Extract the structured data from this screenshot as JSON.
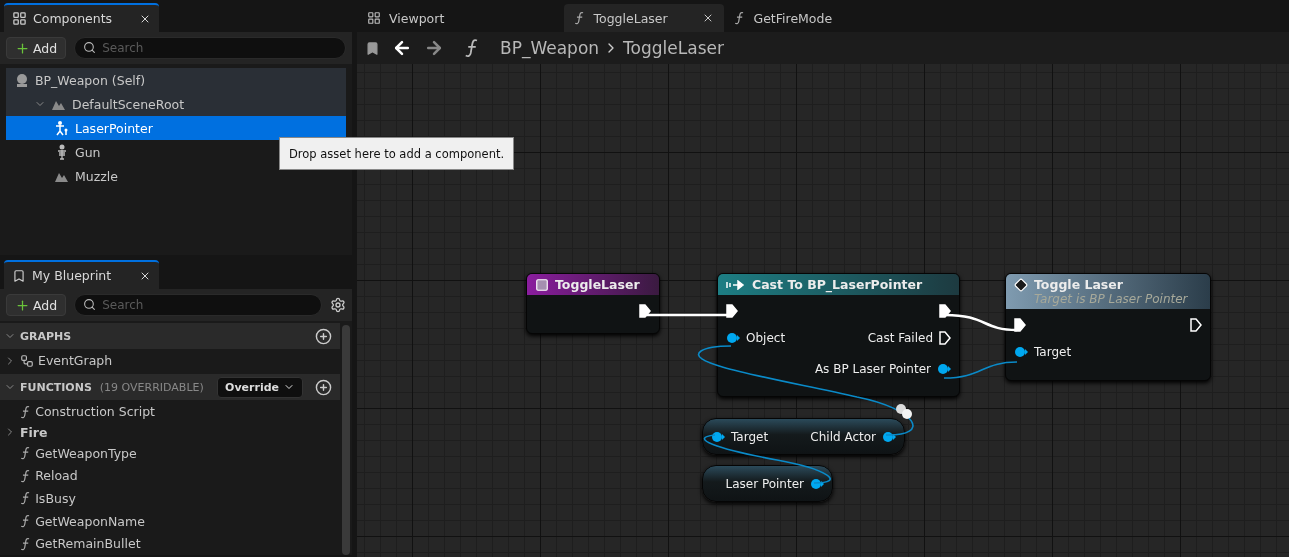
{
  "components_panel": {
    "tab": {
      "title": "Components",
      "selected": true
    },
    "add_label": "Add",
    "search": {
      "placeholder": "Search"
    },
    "tree": [
      {
        "label": "BP_Weapon (Self)",
        "kind": "actor",
        "selected": false,
        "expanded": true,
        "children": [
          {
            "label": "DefaultSceneRoot",
            "kind": "scene",
            "selected": false,
            "expanded": true,
            "children": [
              {
                "label": "LaserPointer",
                "kind": "child-actor",
                "selected": true
              },
              {
                "label": "Gun",
                "kind": "skeleton",
                "selected": false
              },
              {
                "label": "Muzzle",
                "kind": "scene",
                "selected": false
              }
            ]
          }
        ]
      }
    ]
  },
  "tooltip": "Drop asset here to add a component.",
  "my_blueprint": {
    "tab": {
      "title": "My Blueprint",
      "selected": true
    },
    "add_label": "Add",
    "search": {
      "placeholder": "Search"
    },
    "sections": [
      {
        "title": "GRAPHS",
        "expanded": true,
        "items": [
          {
            "label": "EventGraph",
            "kind": "graph",
            "expanded": false
          }
        ]
      },
      {
        "title": "FUNCTIONS",
        "note": "(19 OVERRIDABLE)",
        "dropdown": "Override",
        "expanded": true,
        "items": [
          {
            "label": "Construction Script",
            "kind": "construction"
          },
          {
            "label": "Fire",
            "kind": "category",
            "expanded": false
          },
          {
            "label": "GetWeaponType",
            "kind": "function"
          },
          {
            "label": "Reload",
            "kind": "function"
          },
          {
            "label": "IsBusy",
            "kind": "function"
          },
          {
            "label": "GetWeaponName",
            "kind": "function"
          },
          {
            "label": "GetRemainBullet",
            "kind": "function"
          }
        ]
      }
    ]
  },
  "editor_tabs": [
    {
      "label": "Viewport",
      "kind": "viewport",
      "selected": false
    },
    {
      "label": "ToggleLaser",
      "kind": "function",
      "selected": true
    },
    {
      "label": "GetFireMode",
      "kind": "function",
      "selected": false
    }
  ],
  "breadcrumb": [
    "BP_Weapon",
    "ToggleLaser"
  ],
  "graph": {
    "nodes": [
      {
        "kind": "event",
        "title": "ToggleLaser",
        "rows": [
          {
            "right": {
              "kind": "exec",
              "connected": true
            }
          }
        ]
      },
      {
        "kind": "cast",
        "title": "Cast To BP_LaserPointer",
        "rows": [
          {
            "left": {
              "kind": "exec",
              "connected": true
            },
            "right": {
              "kind": "exec",
              "connected": true
            }
          },
          {
            "left": {
              "kind": "data",
              "label": "Object"
            },
            "right": {
              "kind": "exec",
              "label": "Cast Failed",
              "connected": false
            }
          },
          {
            "right": {
              "kind": "data",
              "label": "As BP Laser Pointer"
            }
          }
        ]
      },
      {
        "kind": "function",
        "title": "Toggle Laser",
        "subtitle": "Target is BP Laser Pointer",
        "rows": [
          {
            "left": {
              "kind": "exec",
              "connected": true
            },
            "right": {
              "kind": "exec",
              "connected": false
            }
          },
          {
            "left": {
              "kind": "data",
              "label": "Target"
            }
          }
        ]
      },
      {
        "kind": "pure",
        "rows": [
          {
            "left": {
              "kind": "data",
              "label": "Target"
            },
            "right": {
              "kind": "data",
              "label": "Child Actor"
            }
          }
        ]
      },
      {
        "kind": "pure",
        "rows": [
          {
            "right": {
              "kind": "data",
              "label": "Laser Pointer"
            }
          }
        ]
      }
    ]
  }
}
